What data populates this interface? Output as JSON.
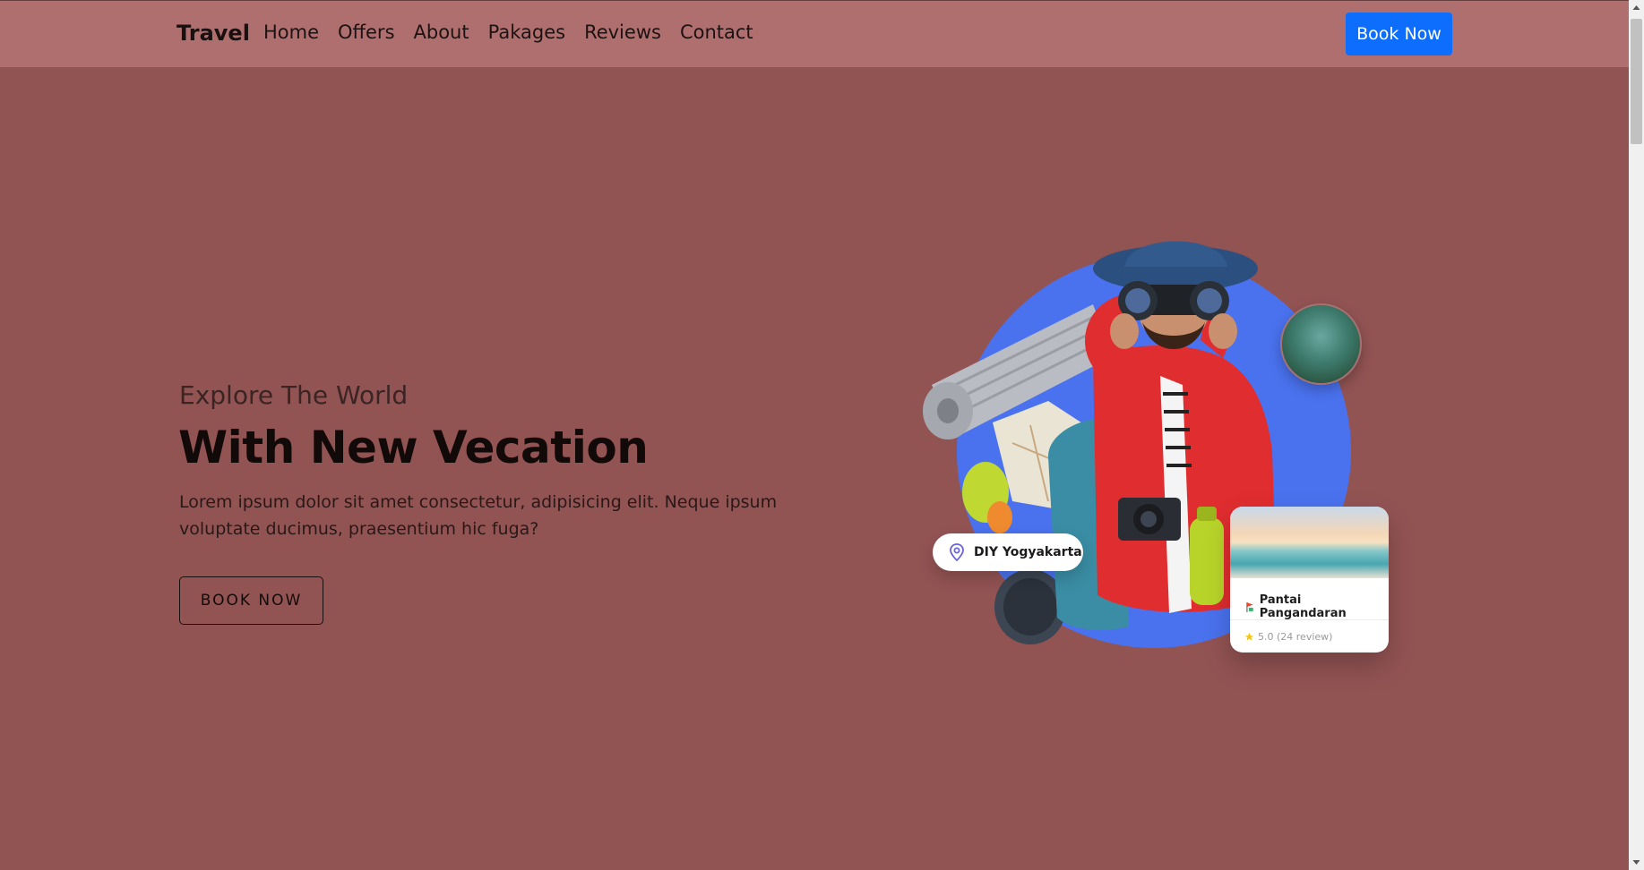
{
  "nav": {
    "brand": "Travel",
    "links": [
      "Home",
      "Offers",
      "About",
      "Pakages",
      "Reviews",
      "Contact"
    ],
    "cta": "Book Now"
  },
  "hero": {
    "eyebrow": "Explore The World",
    "title": "With New Vecation",
    "description": "Lorem ipsum dolor sit amet consectetur, adipisicing elit. Neque ipsum voluptate ducimus, praesentium hic fuga?",
    "button": "BOOK NOW"
  },
  "hero_art": {
    "location_tag": "DIY Yogyakarta",
    "card_title": "Pantai Pangandaran",
    "card_rating": "5.0 (24 review)"
  },
  "colors": {
    "background": "#925353",
    "navbar": "#b06f6f",
    "accent": "#0d6efd",
    "circle": "#4a72ee"
  },
  "icons": [
    "location-pin-icon",
    "map-pin-icon",
    "star-icon",
    "scroll-up-arrow-icon",
    "scroll-down-arrow-icon"
  ]
}
